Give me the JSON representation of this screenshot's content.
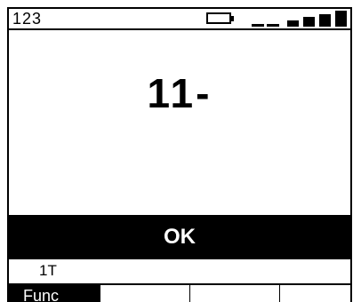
{
  "topbar": {
    "number": "123",
    "battery_icon": "battery-icon",
    "signal_icon": "signal-strength-icon"
  },
  "display": {
    "value": "11-"
  },
  "status": {
    "label": "OK"
  },
  "sub_label": "1T",
  "function_keys": [
    {
      "label": "Func"
    },
    {
      "label": ""
    },
    {
      "label": ""
    },
    {
      "label": ""
    }
  ],
  "colors": {
    "background": "#ffffff",
    "foreground": "#000000",
    "status_bar": "#000000",
    "status_text": "#ffffff"
  }
}
